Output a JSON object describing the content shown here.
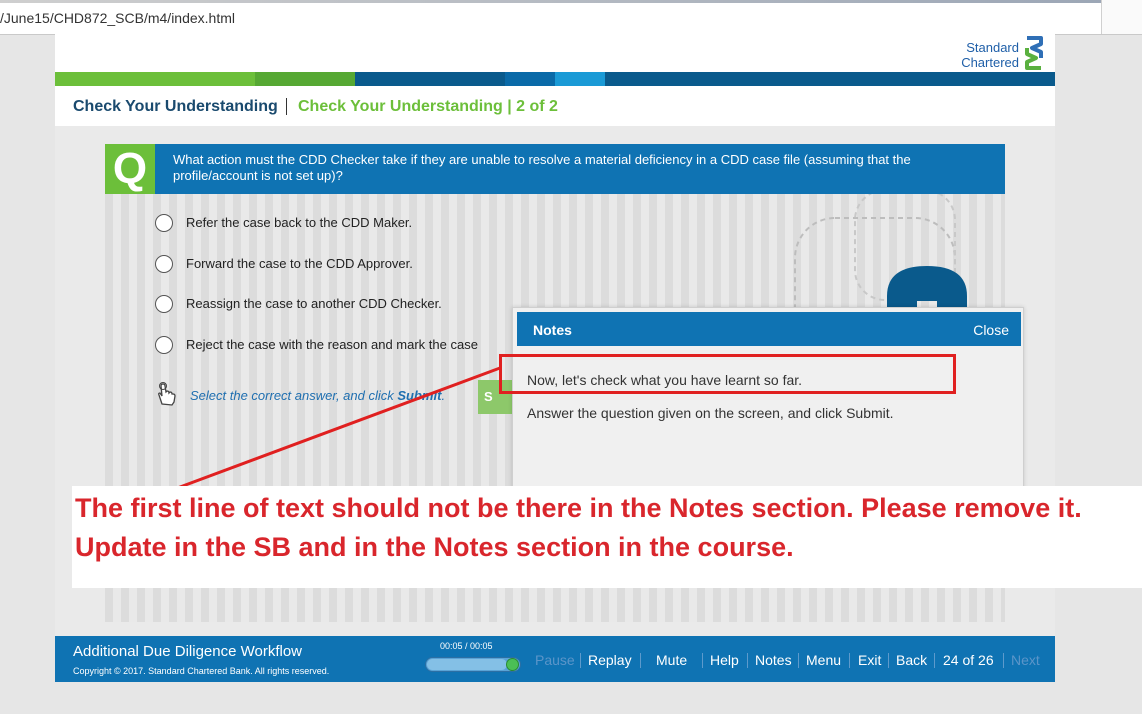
{
  "browser": {
    "url": "/June15/CHD872_SCB/m4/index.html"
  },
  "brand": {
    "line1": "Standard",
    "line2": "Chartered",
    "colors": {
      "green": "#6cbf3a",
      "blue": "#0f73b3",
      "dark": "#1a4a6e"
    }
  },
  "header": {
    "title": "Check Your Understanding",
    "subtitle": "Check Your Understanding | 2 of 2"
  },
  "question": {
    "icon": "Q",
    "text": "What action must the CDD Checker take if they are unable to resolve a material deficiency in a CDD case file (assuming that the profile/account is not set up)?",
    "options": [
      "Refer the case back to the CDD Maker.",
      "Forward the case to the CDD Approver.",
      "Reassign the case to another CDD Checker.",
      "Reject the case with the reason and mark the case"
    ],
    "instruction_prefix": "Select the correct answer, and click ",
    "instruction_bold": "Submit",
    "instruction_suffix": ".",
    "submit_label": "S"
  },
  "notes": {
    "title": "Notes",
    "close": "Close",
    "line1": "Now, let's check what you have learnt so far.",
    "line2": "Answer the question given on the screen, and click Submit."
  },
  "review_comment": {
    "line1": "The first line of text should not be there in the Notes section. Please remove it.",
    "line2": "Update in the SB and in the Notes section in the course.",
    "color": "#d9262c"
  },
  "footer": {
    "course_title": "Additional Due Diligence Workflow",
    "copyright": "Copyright © 2017. Standard Chartered Bank. All rights reserved.",
    "time": "00:05 / 00:05",
    "progress": 1.0,
    "nav": {
      "pause": "Pause",
      "replay": "Replay",
      "mute": "Mute",
      "help": "Help",
      "notes": "Notes",
      "menu": "Menu",
      "exit": "Exit",
      "back": "Back",
      "page": "24 of 26",
      "next": "Next"
    }
  }
}
